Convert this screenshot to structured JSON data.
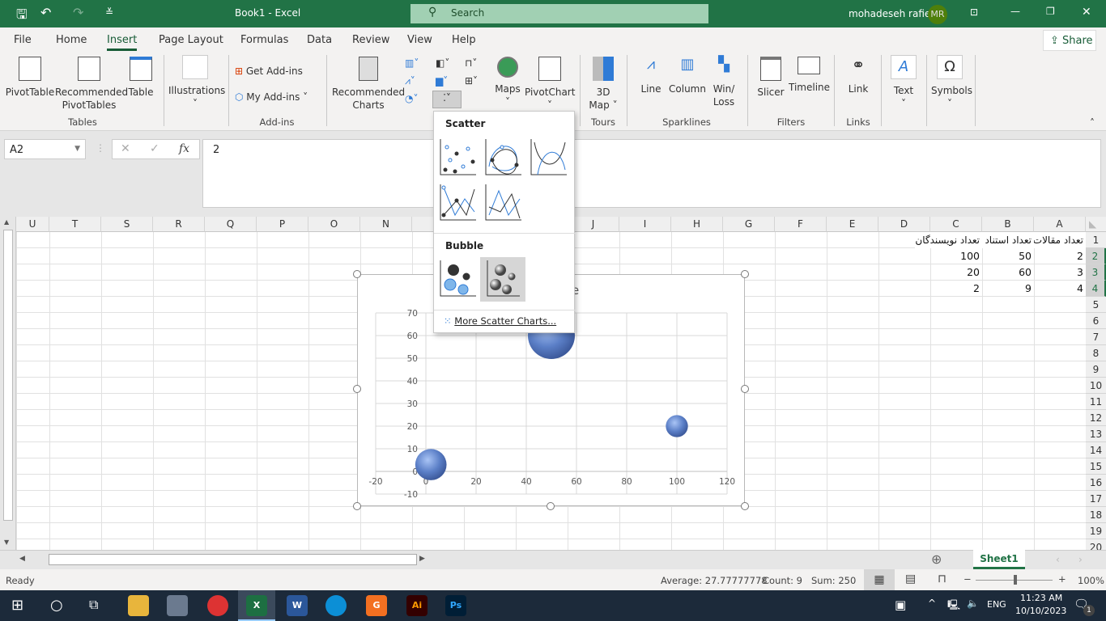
{
  "titlebar": {
    "title": "Book1  -  Excel",
    "search_placeholder": "Search",
    "user": "mohadeseh rafie",
    "initials": "MR"
  },
  "tabs": [
    "File",
    "Home",
    "Insert",
    "Page Layout",
    "Formulas",
    "Data",
    "Review",
    "View",
    "Help"
  ],
  "active_tab": "Insert",
  "share": "Share",
  "ribbon": {
    "pivottable": "PivotTable",
    "recommended_pivottables": [
      "Recommended",
      "PivotTables"
    ],
    "table": "Table",
    "group_tables": "Tables",
    "illustrations": "Illustrations",
    "get_addins": "Get Add-ins",
    "my_addins": "My Add-ins",
    "group_addins": "Add-ins",
    "recommended_charts": [
      "Recommended",
      "Charts"
    ],
    "maps": "Maps",
    "pivotchart": "PivotChart",
    "map3d": [
      "3D",
      "Map"
    ],
    "group_tours": "Tours",
    "line": "Line",
    "column": "Column",
    "winloss": [
      "Win/",
      "Loss"
    ],
    "group_sparklines": "Sparklines",
    "slicer": "Slicer",
    "timeline": "Timeline",
    "group_filters": "Filters",
    "link": "Link",
    "group_links": "Links",
    "text": "Text",
    "symbols": "Symbols"
  },
  "formula_bar": {
    "name_box": "A2",
    "formula": "2"
  },
  "columns": [
    "A",
    "B",
    "C",
    "D",
    "E",
    "F",
    "G",
    "H",
    "I",
    "J",
    "K",
    "L",
    "M",
    "N",
    "O",
    "P",
    "Q",
    "R",
    "S",
    "T",
    "U"
  ],
  "rows": [
    "1",
    "2",
    "3",
    "4",
    "5",
    "6",
    "7",
    "8",
    "9",
    "10",
    "11",
    "12",
    "13",
    "14",
    "15",
    "16",
    "17",
    "18",
    "19",
    "20"
  ],
  "cells": [
    [
      "تعداد مقالات",
      "تعداد استناد",
      "تعداد نویسندگان"
    ],
    [
      "2",
      "50",
      "100"
    ],
    [
      "3",
      "60",
      "20"
    ],
    [
      "4",
      "9",
      "2"
    ]
  ],
  "chart_data": {
    "type": "bubble",
    "title_visible_fragment": "e",
    "x": [
      2,
      50,
      100
    ],
    "y": [
      3,
      60,
      20
    ],
    "size": [
      4,
      9,
      2
    ],
    "xlim": [
      -20,
      120
    ],
    "ylim": [
      -10,
      70
    ],
    "xticks": [
      "-20",
      "0",
      "20",
      "40",
      "60",
      "80",
      "100",
      "120"
    ],
    "yticks": [
      "70",
      "60",
      "50",
      "40",
      "30",
      "20",
      "10",
      "0",
      "-10"
    ],
    "grid": true,
    "color": "#5b7fc7"
  },
  "dropdown": {
    "scatter_header": "Scatter",
    "bubble_header": "Bubble",
    "more": "More Scatter Charts..."
  },
  "sheet_tab": "Sheet1",
  "status": {
    "ready": "Ready",
    "average": "Average: 27.77777778",
    "count": "Count: 9",
    "sum": "Sum: 250",
    "zoom": "100%"
  },
  "taskbar": {
    "lang": "ENG",
    "time": "11:23 AM",
    "date": "10/10/2023",
    "notifications": "1"
  },
  "colors": {
    "excel_green": "#217346",
    "accent": "#185c37"
  }
}
